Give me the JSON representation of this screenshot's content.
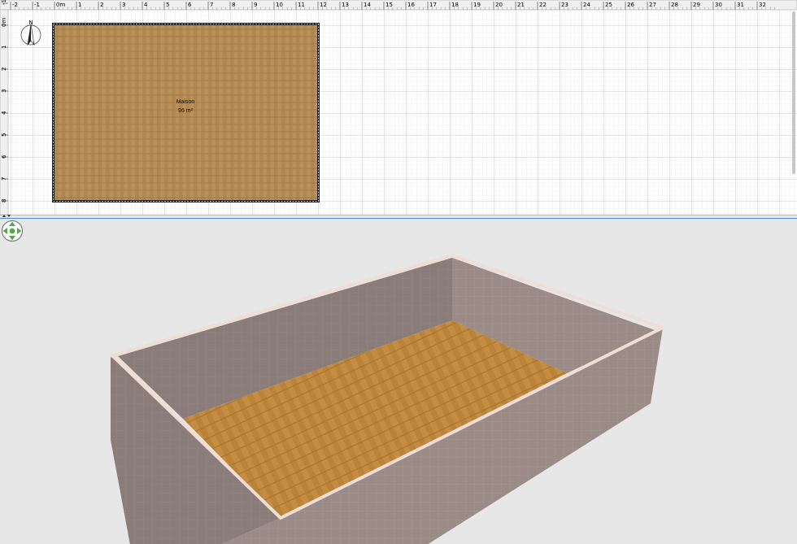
{
  "plan": {
    "h_ruler_labels": [
      "-2",
      "-1",
      "0m",
      "1",
      "2",
      "3",
      "4",
      "5",
      "6",
      "7",
      "8",
      "9",
      "10",
      "11",
      "12",
      "13",
      "14",
      "15",
      "16",
      "17",
      "18",
      "19",
      "20",
      "21",
      "22",
      "23",
      "24",
      "25",
      "26",
      "27",
      "28",
      "29",
      "30",
      "31",
      "32"
    ],
    "v_ruler_labels": [
      "-1",
      "0m",
      "1",
      "2",
      "3",
      "4",
      "5",
      "6",
      "7",
      "8"
    ],
    "room": {
      "name": "Maison",
      "area": "96 m²"
    },
    "compass_label": "N",
    "colors": {
      "floor": "#b98f5a",
      "wall": "#1a1a1a",
      "grid": "#d4d4d4",
      "ruler_bg": "#f0f0f0"
    }
  },
  "view3d": {
    "navigation_icon": "navigation-arrows-icon",
    "colors": {
      "background": "#e7e7e7",
      "wall": "#8a7c78",
      "wall_top": "#f0ddd4",
      "floor": "#c58d42"
    }
  }
}
